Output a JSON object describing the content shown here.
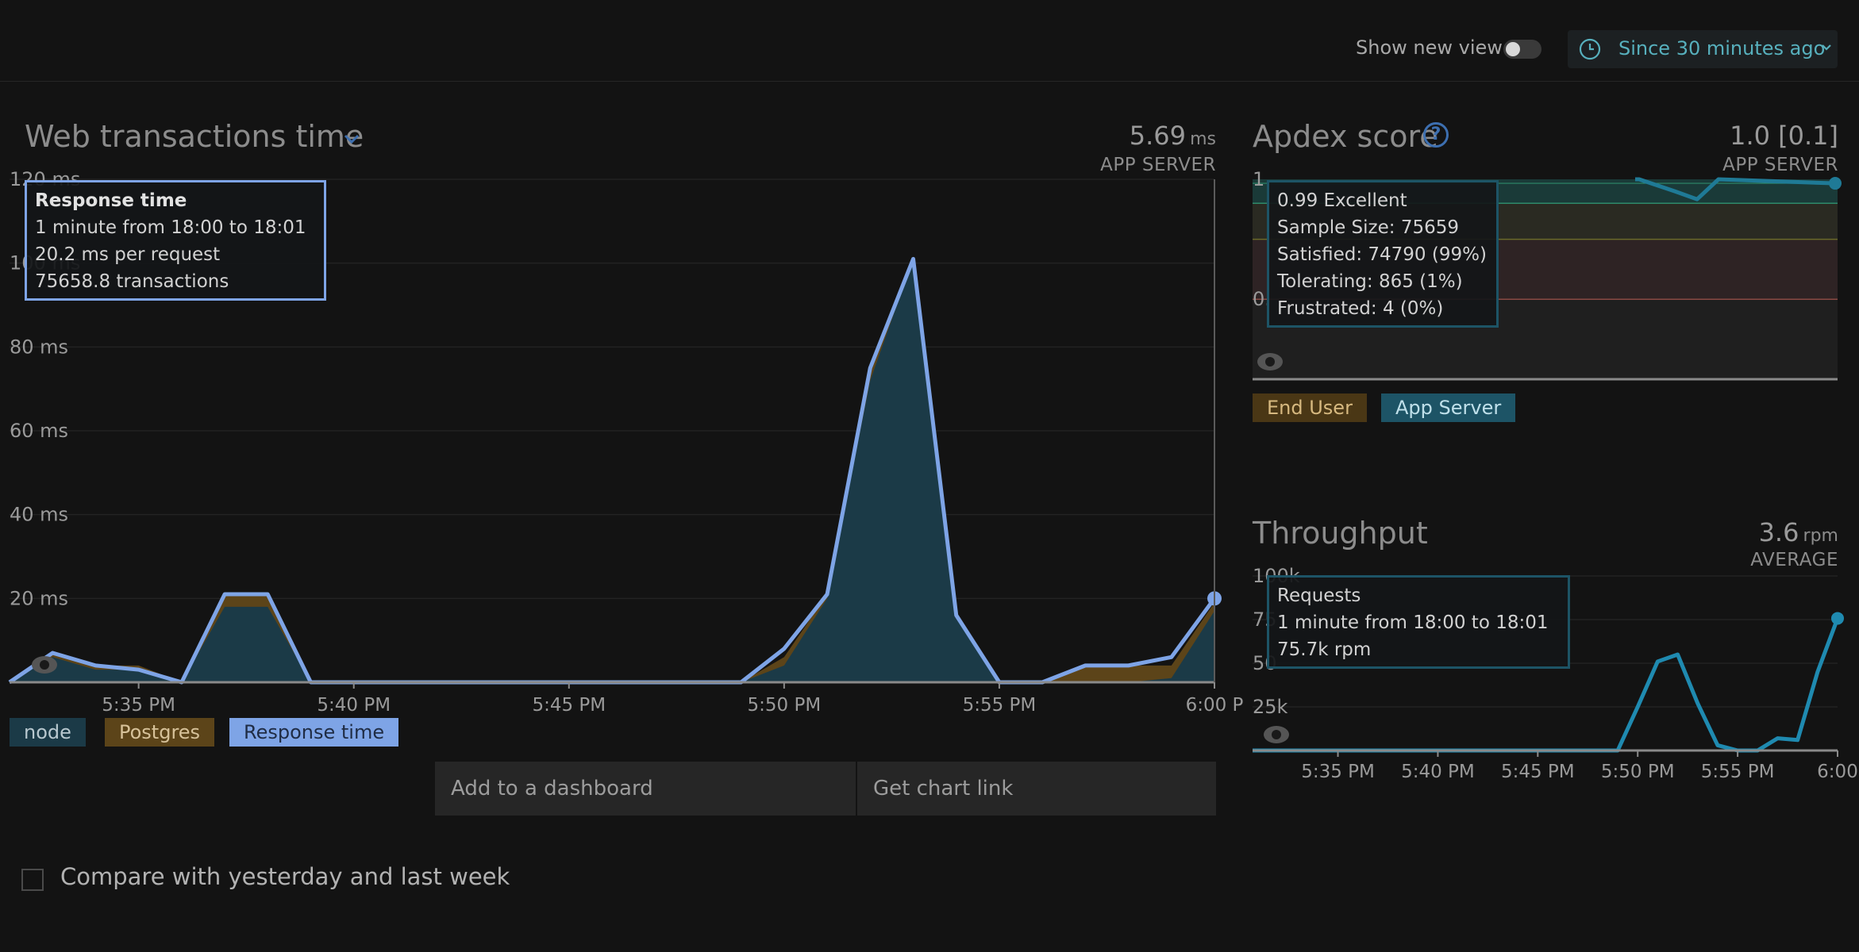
{
  "header": {
    "show_new_view_label": "Show new view",
    "time_range_label": "Since 30 minutes ago"
  },
  "web_transactions": {
    "title": "Web transactions time",
    "value": "5.69",
    "unit": "ms",
    "sublabel": "APP SERVER",
    "y_ticks": [
      "120 ms",
      "100 ms",
      "80 ms",
      "60 ms",
      "40 ms",
      "20 ms"
    ],
    "x_ticks": [
      "5:35 PM",
      "5:40 PM",
      "5:45 PM",
      "5:50 PM",
      "5:55 PM",
      "6:00 P"
    ],
    "tooltip": {
      "title": "Response time",
      "line1": "1 minute from 18:00 to 18:01",
      "line2": "20.2 ms per request",
      "line3": "75658.8 transactions"
    },
    "legend": [
      "node",
      "Postgres",
      "Response time"
    ],
    "buttons": {
      "add_dashboard": "Add to a dashboard",
      "chart_link": "Get chart link"
    }
  },
  "apdex": {
    "title": "Apdex score",
    "value": "1.0 [0.1]",
    "sublabel": "APP SERVER",
    "y_ticks": [
      "1",
      "0."
    ],
    "tooltip": {
      "line1": "0.99 Excellent",
      "line2": "Sample Size: 75659",
      "line3": "Satisfied: 74790 (99%)",
      "line4": "Tolerating: 865 (1%)",
      "line5": "Frustrated: 4 (0%)"
    },
    "legend": [
      "End User",
      "App Server"
    ]
  },
  "throughput": {
    "title": "Throughput",
    "value": "3.6",
    "unit": "rpm",
    "sublabel": "AVERAGE",
    "y_ticks": [
      "100k",
      "75",
      "50",
      "25k"
    ],
    "x_ticks": [
      "5:35 PM",
      "5:40 PM",
      "5:45 PM",
      "5:50 PM",
      "5:55 PM",
      "6:00"
    ],
    "tooltip": {
      "line1": "Requests",
      "line2": "1 minute from 18:00 to 18:01",
      "line3": "75.7k rpm"
    }
  },
  "compare_label": "Compare with yesterday and last week",
  "colors": {
    "node": "#1b3a47",
    "postgres": "#5c4419",
    "response_time": "#7ea4e6",
    "apdex_line": "#1f7a96",
    "throughput_line": "#1f8ab0"
  },
  "chart_data": [
    {
      "type": "area",
      "title": "Web transactions time",
      "ylabel": "ms",
      "ylim": [
        0,
        120
      ],
      "x": [
        "5:32",
        "5:33",
        "5:34",
        "5:35",
        "5:36",
        "5:37",
        "5:38",
        "5:39",
        "5:40",
        "5:41",
        "5:42",
        "5:43",
        "5:44",
        "5:45",
        "5:46",
        "5:47",
        "5:48",
        "5:49",
        "5:50",
        "5:51",
        "5:52",
        "5:53",
        "5:54",
        "5:55",
        "5:56",
        "5:57",
        "5:58",
        "5:59",
        "6:00"
      ],
      "series": [
        {
          "name": "node",
          "values": [
            0,
            6,
            3,
            3,
            0,
            18,
            18,
            0,
            0,
            0,
            0,
            0,
            0,
            0,
            0,
            0,
            0,
            0,
            4,
            20,
            72,
            101,
            16,
            0,
            0,
            0,
            0,
            1,
            17
          ]
        },
        {
          "name": "Postgres",
          "values": [
            0,
            1,
            1,
            1,
            0,
            3,
            3,
            0,
            0,
            0,
            0,
            0,
            0,
            0,
            0,
            0,
            0,
            0,
            2,
            1,
            3,
            0,
            0,
            0,
            0,
            4,
            4,
            3,
            2
          ]
        },
        {
          "name": "Response time",
          "values": [
            0,
            7,
            4,
            3,
            0,
            21,
            21,
            0,
            0,
            0,
            0,
            0,
            0,
            0,
            0,
            0,
            0,
            0,
            8,
            21,
            75,
            101,
            16,
            0,
            0,
            4,
            4,
            6,
            20
          ]
        }
      ]
    },
    {
      "type": "line",
      "title": "Apdex score",
      "ylim": [
        0.5,
        1
      ],
      "x": [
        "5:56",
        "5:57",
        "5:58",
        "5:59",
        "6:00"
      ],
      "series": [
        {
          "name": "App Server",
          "values": [
            1.0,
            0.97,
            0.95,
            1.0,
            0.99
          ]
        }
      ]
    },
    {
      "type": "line",
      "title": "Throughput",
      "ylim": [
        0,
        100000
      ],
      "x": [
        "5:32",
        "5:35",
        "5:40",
        "5:45",
        "5:49",
        "5:50",
        "5:51",
        "5:52",
        "5:53",
        "5:54",
        "5:55",
        "5:56",
        "5:57",
        "5:58",
        "5:59",
        "6:00"
      ],
      "series": [
        {
          "name": "Requests",
          "values": [
            0,
            0,
            0,
            0,
            0,
            25000,
            51000,
            55000,
            27000,
            3000,
            0,
            0,
            7000,
            6000,
            45000,
            75700
          ]
        }
      ]
    }
  ]
}
